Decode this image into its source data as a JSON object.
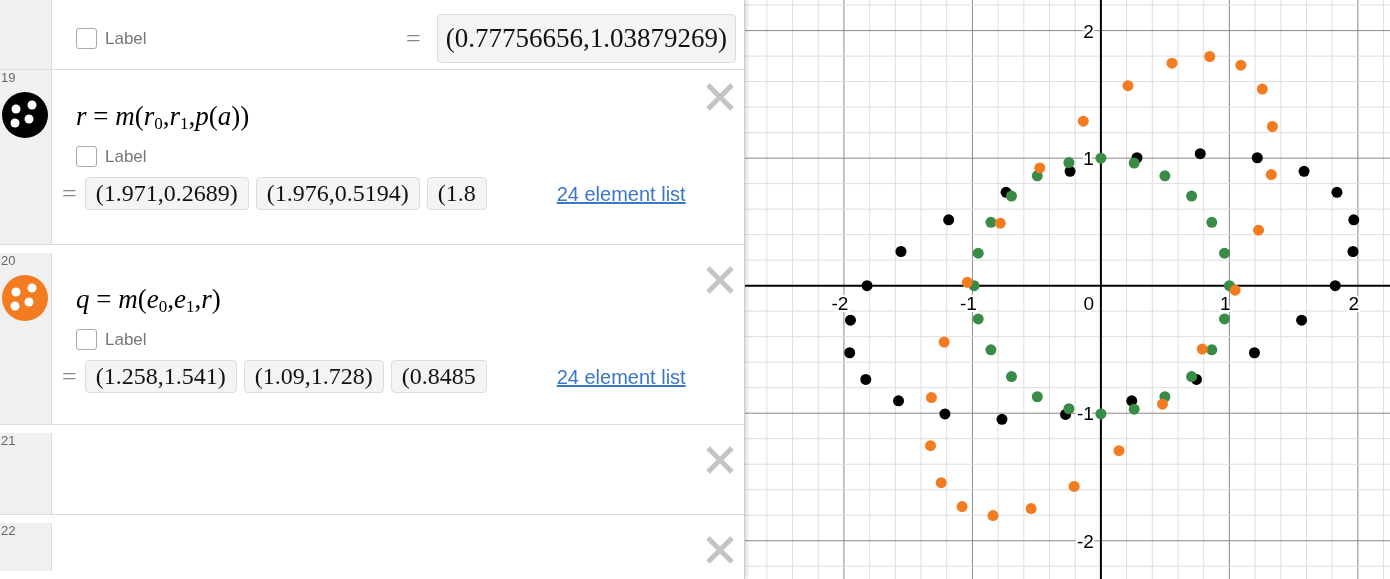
{
  "expression_list": [
    {
      "kind": "value",
      "label": "Label",
      "label_checked": false,
      "equals": "=",
      "value": "(0.77756656,1.03879269)"
    },
    {
      "kind": "list",
      "number": "19",
      "color": "#000000",
      "expression": "*r* = *m*(*r*$_{0}$,*r*$_{1}$,*p*(*a*))",
      "label": "Label",
      "label_checked": false,
      "equals": "=",
      "values": [
        "(1.971,0.2689)",
        "(1.976,0.5194)",
        "(1.8"
      ],
      "list_link": "24 element list"
    },
    {
      "kind": "list",
      "number": "20",
      "color": "#f47c20",
      "expression": "*q* = *m*(*e*$_{0}$,*e*$_{1}$,*r*)",
      "label": "Label",
      "label_checked": false,
      "equals": "=",
      "values": [
        "(1.258,1.541)",
        "(1.09,1.728)",
        "(0.8485"
      ],
      "list_link": "24 element list"
    },
    {
      "kind": "empty",
      "number": "21"
    },
    {
      "kind": "empty",
      "number": "22"
    }
  ],
  "graph": {
    "chart_data": {
      "type": "scatter",
      "grid": true,
      "xlim": [
        -2.77,
        2.25
      ],
      "ylim": [
        -2.3,
        2.24
      ],
      "xticks": [
        -2,
        -1,
        0,
        1,
        2
      ],
      "yticks": [
        -2,
        -1,
        1,
        2
      ],
      "series": [
        {
          "color": "#000000",
          "x": [
            -1.82,
            -1.556,
            -1.185,
            -0.738,
            -0.24,
            0.281,
            0.773,
            1.217,
            1.581,
            1.837,
            1.968,
            1.962,
            1.824,
            1.562,
            1.195,
            0.744,
            0.24,
            -0.275,
            -0.77,
            -1.214,
            -1.575,
            -1.83,
            -1.955,
            -1.949
          ],
          "values": [
            0,
            0.268,
            0.516,
            0.732,
            0.897,
            1.003,
            1.035,
            1.003,
            0.897,
            0.732,
            0.516,
            0.268,
            0,
            -0.271,
            -0.526,
            -0.735,
            -0.903,
            -1.01,
            -1.048,
            -1.006,
            -0.903,
            -0.735,
            -0.526,
            -0.271
          ]
        },
        {
          "color": "#388c46",
          "x": [
            -0.987,
            -0.955,
            -0.856,
            -0.696,
            -0.495,
            -0.249,
            0,
            0.259,
            0.498,
            0.706,
            0.863,
            0.962,
            1,
            0.962,
            0.863,
            0.706,
            0.498,
            0.259,
            0,
            -0.249,
            -0.495,
            -0.696,
            -0.856,
            -0.955
          ],
          "values": [
            0,
            0.255,
            0.497,
            0.703,
            0.861,
            0.965,
            1,
            0.961,
            0.861,
            0.703,
            0.497,
            0.255,
            0,
            -0.261,
            -0.503,
            -0.713,
            -0.871,
            -0.968,
            -1.006,
            -0.965,
            -0.871,
            -0.713,
            -0.503,
            -0.261
          ]
        },
        {
          "color": "#f47c20",
          "x": [
            -1.04,
            -0.783,
            -0.476,
            -0.137,
            0.211,
            0.553,
            0.847,
            1.089,
            1.256,
            1.335,
            1.326,
            1.227,
            1.045,
            0.789,
            0.479,
            0.141,
            -0.208,
            -0.543,
            -0.84,
            -1.08,
            -1.243,
            -1.326,
            -1.319,
            -1.22
          ],
          "values": [
            0.026,
            0.49,
            0.923,
            1.29,
            1.568,
            1.745,
            1.797,
            1.729,
            1.542,
            1.248,
            0.871,
            0.435,
            -0.035,
            -0.497,
            -0.929,
            -1.294,
            -1.574,
            -1.748,
            -1.803,
            -1.732,
            -1.545,
            -1.255,
            -0.877,
            -0.442
          ]
        }
      ]
    }
  }
}
